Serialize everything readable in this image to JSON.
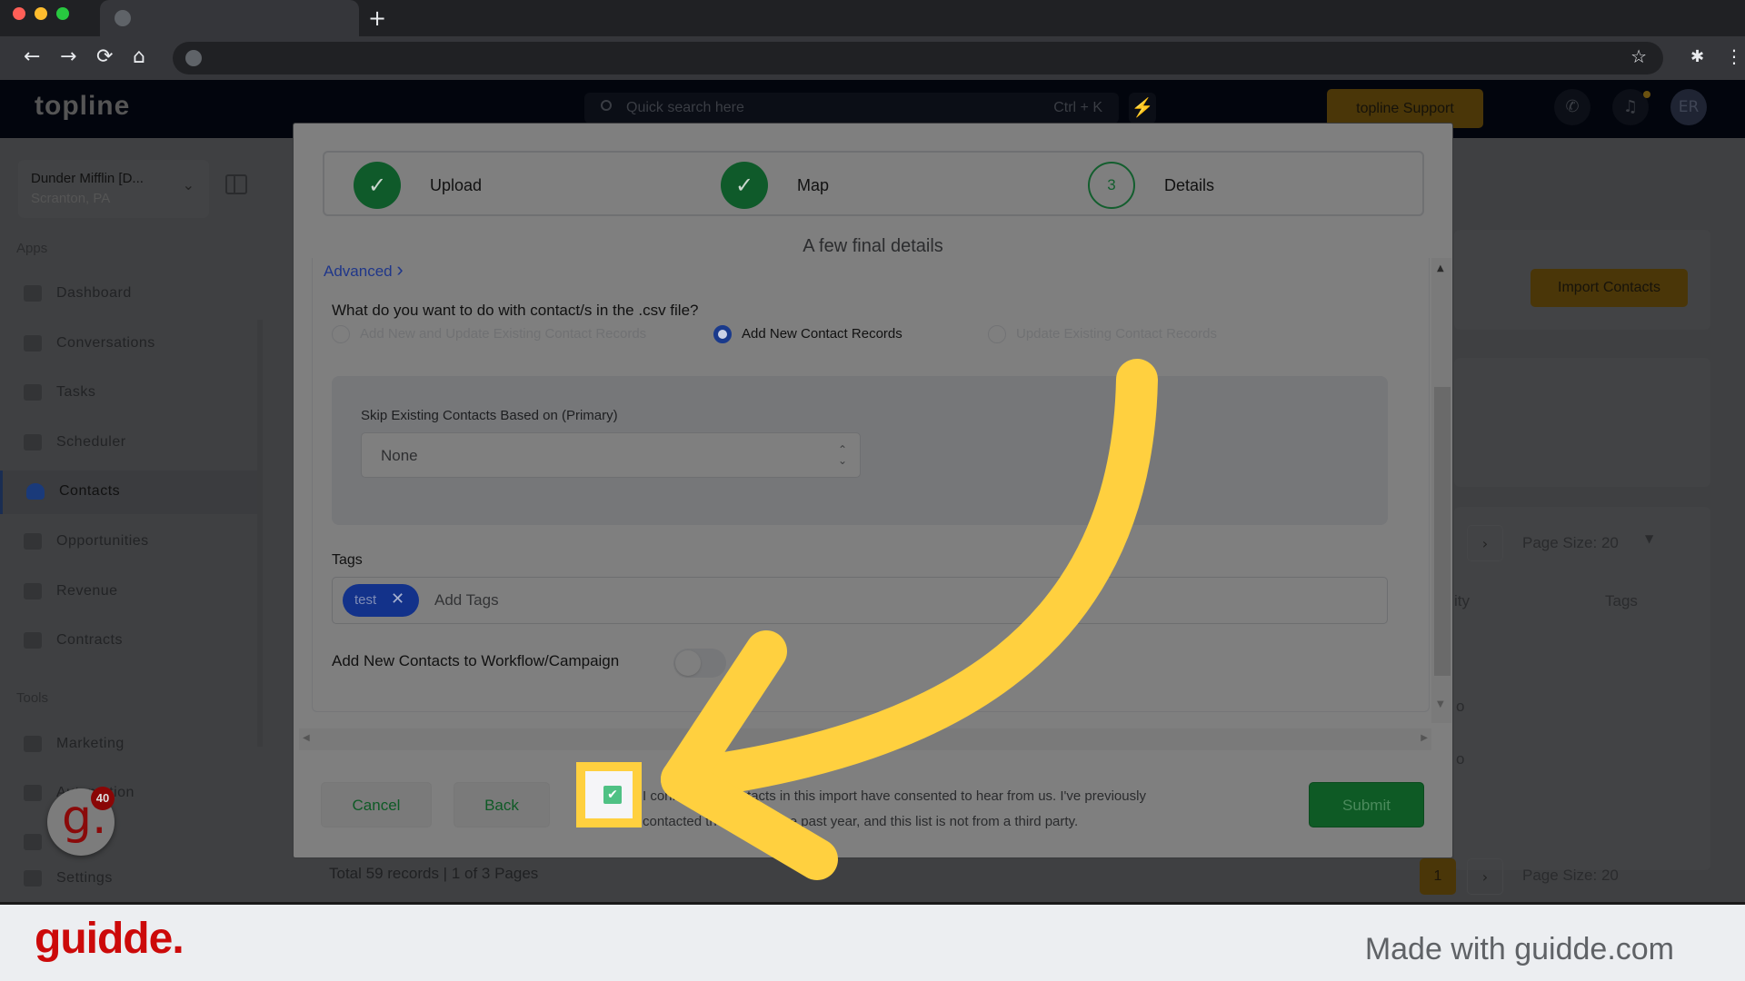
{
  "browser": {
    "traffic_lights": [
      "#ff5f57",
      "#febc2e",
      "#28c840"
    ],
    "new_tab_label": "+",
    "nav": {
      "back": "←",
      "forward": "→",
      "reload": "⟳",
      "home": "⌂"
    },
    "star": "☆",
    "extensions": "✱",
    "menu": "⋮"
  },
  "app": {
    "logo": "topline",
    "search": {
      "placeholder": "Quick search here",
      "shortcut": "Ctrl + K"
    },
    "bolt": "⚡",
    "support_label": "topline Support",
    "phone_icon": "✆",
    "bell_icon": "🔔",
    "avatar_initials": "ER"
  },
  "sidebar": {
    "account": {
      "name": "Dunder Mifflin [D...",
      "location": "Scranton, PA"
    },
    "apps_label": "Apps",
    "apps": [
      {
        "label": "Dashboard",
        "active": false
      },
      {
        "label": "Conversations",
        "active": false
      },
      {
        "label": "Tasks",
        "active": false
      },
      {
        "label": "Scheduler",
        "active": false
      },
      {
        "label": "Contacts",
        "active": true
      },
      {
        "label": "Opportunities",
        "active": false
      },
      {
        "label": "Revenue",
        "active": false
      },
      {
        "label": "Contracts",
        "active": false
      }
    ],
    "tools_label": "Tools",
    "tools": [
      {
        "label": "Marketing"
      },
      {
        "label": "Automation"
      },
      {
        "label": ""
      },
      {
        "label": "Settings"
      }
    ]
  },
  "background": {
    "import_button": "Import Contacts",
    "page_size_label": "Page Size: 20",
    "next_arrow": "›",
    "current_page": "1",
    "column_partial": "ity",
    "column_tags": "Tags",
    "cell_partial_1": "o",
    "cell_partial_2": "o",
    "status": "Total 59 records | 1 of 3 Pages"
  },
  "modal": {
    "steps": [
      {
        "number": "1",
        "label": "Upload",
        "status": "complete"
      },
      {
        "number": "2",
        "label": "Map",
        "status": "complete"
      },
      {
        "number": "3",
        "label": "Details",
        "status": "current"
      }
    ],
    "checkmark": "✓",
    "title": "A few final details",
    "advanced_link": "Advanced",
    "advanced_chevron": "›",
    "question": "What do you want to do with contact/s in the .csv file?",
    "radio_options": [
      {
        "label": "Add New and Update Existing Contact Records",
        "checked": false
      },
      {
        "label": "Add New Contact Records",
        "checked": true
      },
      {
        "label": "Update Existing Contact Records",
        "checked": false
      }
    ],
    "skip": {
      "label": "Skip Existing Contacts Based on (Primary)",
      "value": "None"
    },
    "tags": {
      "label": "Tags",
      "chips": [
        "test"
      ],
      "placeholder": "Add Tags"
    },
    "workflow": {
      "label": "Add New Contacts to Workflow/Campaign",
      "enabled": false
    },
    "footer": {
      "cancel": "Cancel",
      "back": "Back",
      "submit": "Submit",
      "consent_checked": true,
      "consent_line1": "I confirm that contacts in this import have consented to hear from us. I've previously",
      "consent_line2": "contacted them within the past year, and this list is not from a third party."
    }
  },
  "guidde": {
    "bubble_letter": "g.",
    "badge_count": "40",
    "brand": "guidde.",
    "made_with": "Made with guidde.com",
    "highlight_color": "#ffd03f",
    "brand_color": "#cc0a0a"
  }
}
